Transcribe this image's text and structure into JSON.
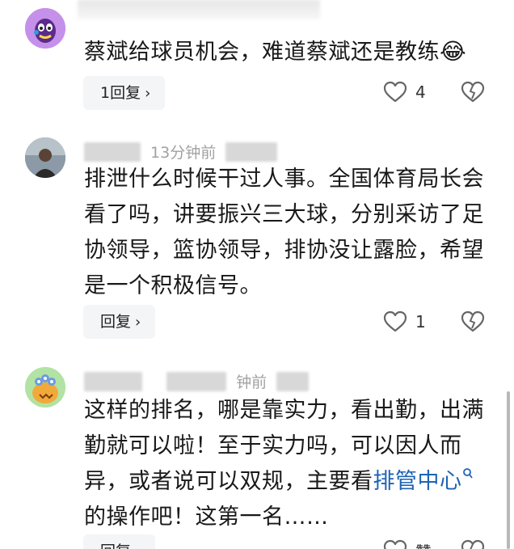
{
  "comments": [
    {
      "id": "c1",
      "text": "蔡斌给球员机会，难道蔡斌还是教练",
      "emoji": "😂",
      "reply_label": "1回复",
      "likes": "4"
    },
    {
      "id": "c2",
      "time": "13分钟前",
      "text": "排泄什么时候干过人事。全国体育局长会看了吗，讲要振兴三大球，分别采访了足协领导，篮协领导，排协没让露脸，希望是一个积极信号。",
      "reply_label": "回复",
      "likes": "1"
    },
    {
      "id": "c3",
      "time": "钟前",
      "text_part1": "这样的排名，哪是靠实力，看出勤，出满勤就可以啦！至于实力吗，可以因人而异，或者说可以双规，主要看",
      "link_text": "排管中心",
      "text_part2": "的操作吧！这第一名……",
      "reply_label": "回复",
      "likes": "赞"
    }
  ],
  "colors": {
    "link": "#1e63b4",
    "meta": "#a2a2a2",
    "button_bg": "#f4f5f7"
  },
  "icons": [
    "heart-outline-icon",
    "dislike-broken-heart-icon",
    "search-icon",
    "chevron-right-icon"
  ]
}
